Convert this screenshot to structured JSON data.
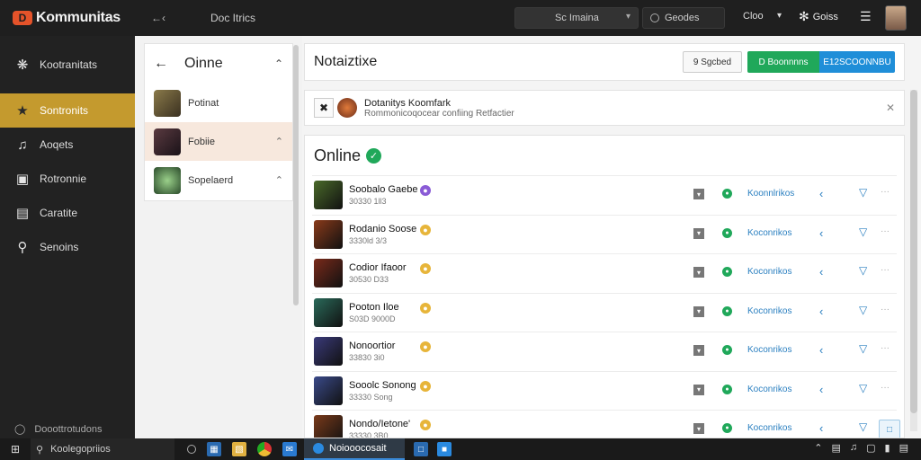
{
  "topbar": {
    "app_name": "Kommunitas",
    "logo_letter": "D",
    "link": "Doc Itrics",
    "search_label": "Sc Imaina",
    "status_label": "Geodes",
    "user_label": "Cloo",
    "brand_label": "Goiss"
  },
  "sidebar": {
    "items": [
      {
        "label": "Kootranitats",
        "icon": "puzzle-icon"
      },
      {
        "label": "Sontronits",
        "icon": "key-icon",
        "active": true
      },
      {
        "label": "Aoqets",
        "icon": "music-icon"
      },
      {
        "label": "Rotronnie",
        "icon": "monitor-icon"
      },
      {
        "label": "Caratite",
        "icon": "list-icon"
      },
      {
        "label": "Senoins",
        "icon": "search-icon"
      }
    ],
    "footer": "Dooottrotudons"
  },
  "panel": {
    "title": "Oinne",
    "items": [
      {
        "label": "Potinat",
        "selected": false,
        "color": "#6b5a3a"
      },
      {
        "label": "Fobiie",
        "selected": true,
        "color": "#3a2a30"
      },
      {
        "label": "Sopelaerd",
        "selected": false,
        "color": "#3b6b3a"
      }
    ]
  },
  "main": {
    "title": "Notaiztixe",
    "btn_light": "9 Sgcbed",
    "btn_green": "D Boonnnns",
    "btn_blue": "E12SCOONNBU",
    "alert": {
      "title": "Dotanitys Koomfark",
      "subtitle": "Rommonicoqocear confiing Retfactier"
    },
    "online_title": "Online",
    "rows": [
      {
        "name": "Soobalo Gaebe",
        "sub": "30330 1ll3",
        "badge": "purple",
        "link": "Koonnlrikos",
        "color": "#4a6a2a"
      },
      {
        "name": "Rodanio Soose",
        "sub": "3330ld 3/3",
        "badge": "gold",
        "link": "Koconrikos",
        "color": "#8a3a1a"
      },
      {
        "name": "Codior Ifaoor",
        "sub": "30530 D33",
        "badge": "gold",
        "link": "Koconrikos",
        "color": "#7a2a1a"
      },
      {
        "name": "Pooton Iloe",
        "sub": "S03D 9000D",
        "badge": "gold",
        "link": "Koconrikos",
        "color": "#2a6a5a"
      },
      {
        "name": "Nonoortior",
        "sub": "33830 3i0",
        "badge": "gold",
        "link": "Koconrikos",
        "color": "#3a3a7a"
      },
      {
        "name": "Sooolc Sonong",
        "sub": "33330 Song",
        "badge": "gold",
        "link": "Koconrikos",
        "color": "#3a4a8a"
      },
      {
        "name": "Nondo/Ietone'",
        "sub": "33330 3B0",
        "badge": "gold",
        "link": "Koconrikos",
        "color": "#7a3a1a"
      }
    ]
  },
  "taskbar": {
    "search": "Koolegopriios",
    "active": "Noiooocosait"
  }
}
